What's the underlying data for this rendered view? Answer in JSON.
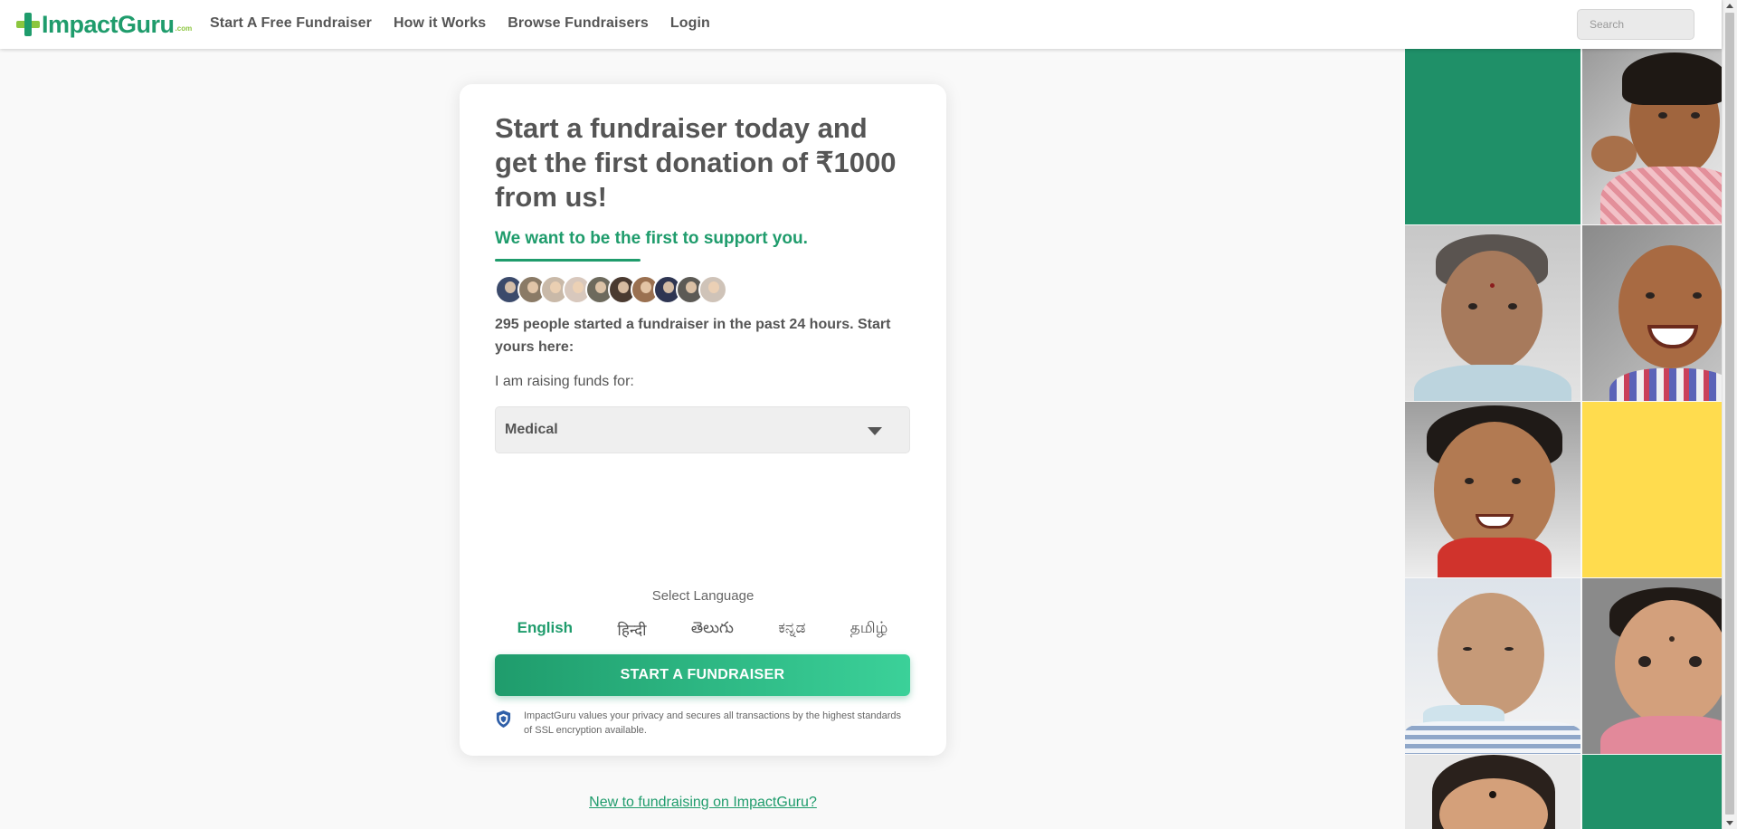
{
  "header": {
    "logo": "ImpactGuru",
    "logo_tag": ".com",
    "nav": [
      {
        "label": "Start A Free Fundraiser"
      },
      {
        "label": "How it Works"
      },
      {
        "label": "Browse Fundraisers"
      },
      {
        "label": "Login"
      }
    ],
    "search_placeholder": "Search"
  },
  "card": {
    "headline": "Start a fundraiser today and get the first donation of ₹1000 from us!",
    "subheadline": "We want to be the first to support you.",
    "avatar_count": 10,
    "count_text": "295 people started a fundraiser in the past 24 hours. Start yours here:",
    "raise_label": "I am raising funds for:",
    "select_value": "Medical",
    "language_label": "Select Language",
    "languages": [
      {
        "label": "English",
        "active": true
      },
      {
        "label": "हिन्दी",
        "active": false
      },
      {
        "label": "తెలుగు",
        "active": false
      },
      {
        "label": "ಕನ್ನಡ",
        "active": false
      },
      {
        "label": "தமிழ்",
        "active": false
      }
    ],
    "cta_label": "START A FUNDRAISER",
    "privacy_text": "ImpactGuru values your privacy and secures all transactions by the highest standards of SSL encryption available."
  },
  "footer_link": "New to fundraising on ImpactGuru?",
  "colors": {
    "brand_green": "#1f9c6c",
    "brand_light_green": "#8cc63f",
    "tile_yellow": "#ffdc4e",
    "text_gray": "#555555"
  }
}
